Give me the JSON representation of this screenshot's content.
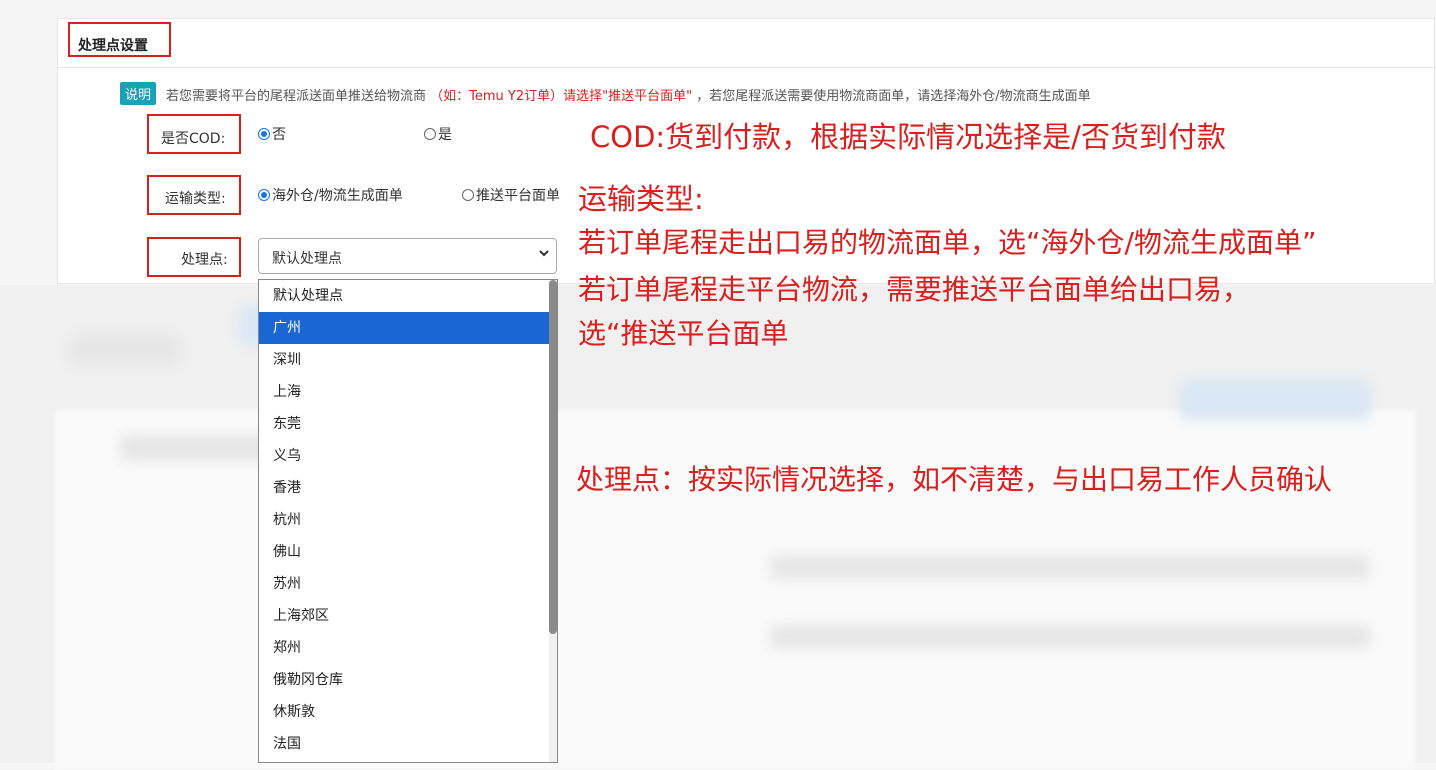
{
  "section": {
    "title": "处理点设置"
  },
  "note": {
    "badge": "说明",
    "text_a": "若您需要将平台的尾程派送面单推送给物流商",
    "text_red": "（如：Temu Y2订单）请选择\"推送平台面单\"",
    "text_b": "，若您尾程派送需要使用物流商面单，请选择海外仓/物流商生成面单"
  },
  "cod": {
    "label": "是否COD:",
    "options": [
      {
        "label": "否",
        "selected": true
      },
      {
        "label": "是",
        "selected": false
      }
    ]
  },
  "shipping": {
    "label": "运输类型:",
    "options": [
      {
        "label": "海外仓/物流生成面单",
        "selected": true
      },
      {
        "label": "推送平台面单",
        "selected": false
      }
    ]
  },
  "site": {
    "label": "处理点:",
    "value": "默认处理点",
    "options": [
      "默认处理点",
      "广州",
      "深圳",
      "上海",
      "东莞",
      "义乌",
      "香港",
      "杭州",
      "佛山",
      "苏州",
      "上海郊区",
      "郑州",
      "俄勒冈仓库",
      "休斯敦",
      "法国"
    ],
    "highlighted": "广州"
  },
  "annotations": {
    "cod": "COD:货到付款，根据实际情况选择是/否货到付款",
    "shipping_title": "运输类型:",
    "shipping_line1": "若订单尾程走出口易的物流面单，选“海外仓/物流生成面单”",
    "shipping_line2": "若订单尾程走平台物流，需要推送平台面单给出口易，",
    "shipping_line3": "选“推送平台面单",
    "site": "处理点：按实际情况选择，如不清楚，与出口易工作人员确认"
  },
  "colors": {
    "annotation_red": "#d9201f",
    "badge": "#17a2b8",
    "highlight": "#1a66d2"
  }
}
